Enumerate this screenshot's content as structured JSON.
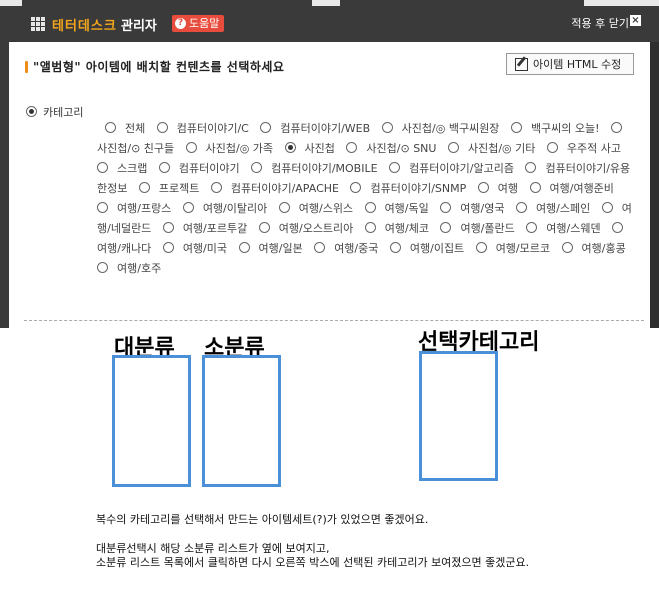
{
  "titlebar": {
    "brand": "테터데스크",
    "admin": "관리자",
    "help": "도움말",
    "close": "적용 후 닫기",
    "close_x": "×"
  },
  "section": {
    "title": "\"앨범형\" 아이템에 배치할 컨텐츠를 선택하세요",
    "edit_button": "아이템 HTML 수정"
  },
  "category_root": {
    "label": "카테고리",
    "checked": true
  },
  "category_options": [
    {
      "label": "전체",
      "checked": false
    },
    {
      "label": "컴퓨터이야기/C",
      "checked": false
    },
    {
      "label": "컴퓨터이야기/WEB",
      "checked": false
    },
    {
      "label": "사진첩/◎ 백구씨원장",
      "checked": false
    },
    {
      "label": "백구씨의 오늘!",
      "checked": false
    },
    {
      "label": "사진첩/⊙ 친구들",
      "checked": false
    },
    {
      "label": "사진첩/◎ 가족",
      "checked": false
    },
    {
      "label": "사진첩",
      "checked": true
    },
    {
      "label": "사진첩/⊙ SNU",
      "checked": false
    },
    {
      "label": "사진첩/◎ 기타",
      "checked": false
    },
    {
      "label": "우주적 사고",
      "checked": false
    },
    {
      "label": "스크랩",
      "checked": false
    },
    {
      "label": "컴퓨터이야기",
      "checked": false
    },
    {
      "label": "컴퓨터이야기/MOBILE",
      "checked": false
    },
    {
      "label": "컴퓨터이야기/알고리즘",
      "checked": false
    },
    {
      "label": "컴퓨터이야기/유용한정보",
      "checked": false
    },
    {
      "label": "프로젝트",
      "checked": false
    },
    {
      "label": "컴퓨터이야기/APACHE",
      "checked": false
    },
    {
      "label": "컴퓨터이야기/SNMP",
      "checked": false
    },
    {
      "label": "여행",
      "checked": false
    },
    {
      "label": "여행/여행준비",
      "checked": false
    },
    {
      "label": "여행/프랑스",
      "checked": false
    },
    {
      "label": "여행/이탈리아",
      "checked": false
    },
    {
      "label": "여행/스위스",
      "checked": false
    },
    {
      "label": "여행/독일",
      "checked": false
    },
    {
      "label": "여행/영국",
      "checked": false
    },
    {
      "label": "여행/스페인",
      "checked": false
    },
    {
      "label": "여행/네덜란드",
      "checked": false
    },
    {
      "label": "여행/포르투갈",
      "checked": false
    },
    {
      "label": "여행/오스트리아",
      "checked": false
    },
    {
      "label": "여행/체코",
      "checked": false
    },
    {
      "label": "여행/폴란드",
      "checked": false
    },
    {
      "label": "여행/스웨덴",
      "checked": false
    },
    {
      "label": "여행/캐나다",
      "checked": false
    },
    {
      "label": "여행/미국",
      "checked": false
    },
    {
      "label": "여행/일본",
      "checked": false
    },
    {
      "label": "여행/중국",
      "checked": false
    },
    {
      "label": "여행/이집트",
      "checked": false
    },
    {
      "label": "여행/모르코",
      "checked": false
    },
    {
      "label": "여행/홍콩",
      "checked": false
    },
    {
      "label": "여행/호주",
      "checked": false
    }
  ],
  "mockup": {
    "major_label": "대분류",
    "minor_label": "소분류",
    "selected_label": "선택카테고리"
  },
  "notes": {
    "line1": "복수의 카테고리를 선택해서 만드는 아이템세트(?)가 있었으면 좋겠어요.",
    "line2": "대분류선택시 해당 소분류 리스트가 옆에 보여지고,",
    "line3": "소분류 리스트 목록에서 클릭하면 다시 오른쪽 박스에 선택된 카테고리가 보여졌으면 좋겠군요."
  },
  "colors": {
    "dialog_bg": "#3a3a3a",
    "brand": "#f3a51c",
    "help_bg": "#e74c3c",
    "accent_bar": "#f08c1a",
    "box_border": "#4a90d9"
  },
  "icons": {
    "app": "grid-icon",
    "help": "question-icon",
    "close": "close-icon",
    "edit": "edit-pencil-icon"
  }
}
